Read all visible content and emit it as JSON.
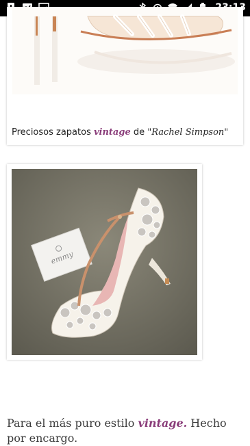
{
  "status_bar": {
    "time": "23:13",
    "left_icons": [
      "alert-icon",
      "media-icon",
      "image-icon"
    ],
    "right_icons": [
      "bluetooth-icon",
      "alarm-icon",
      "wifi-icon",
      "signal-icon",
      "battery-icon"
    ]
  },
  "posts": [
    {
      "caption_before": "Preciosos zapatos ",
      "caption_highlight": "vintage",
      "caption_middle": " de ",
      "caption_author": "\"Rachel Simpson\""
    },
    {
      "card_text": "emmy"
    }
  ],
  "paragraph": {
    "before": "Para el más puro estilo ",
    "highlight": "vintage.",
    "after": " Hecho por encargo."
  },
  "colors": {
    "accent": "#8a3d7a",
    "status_bar": "#000000"
  }
}
